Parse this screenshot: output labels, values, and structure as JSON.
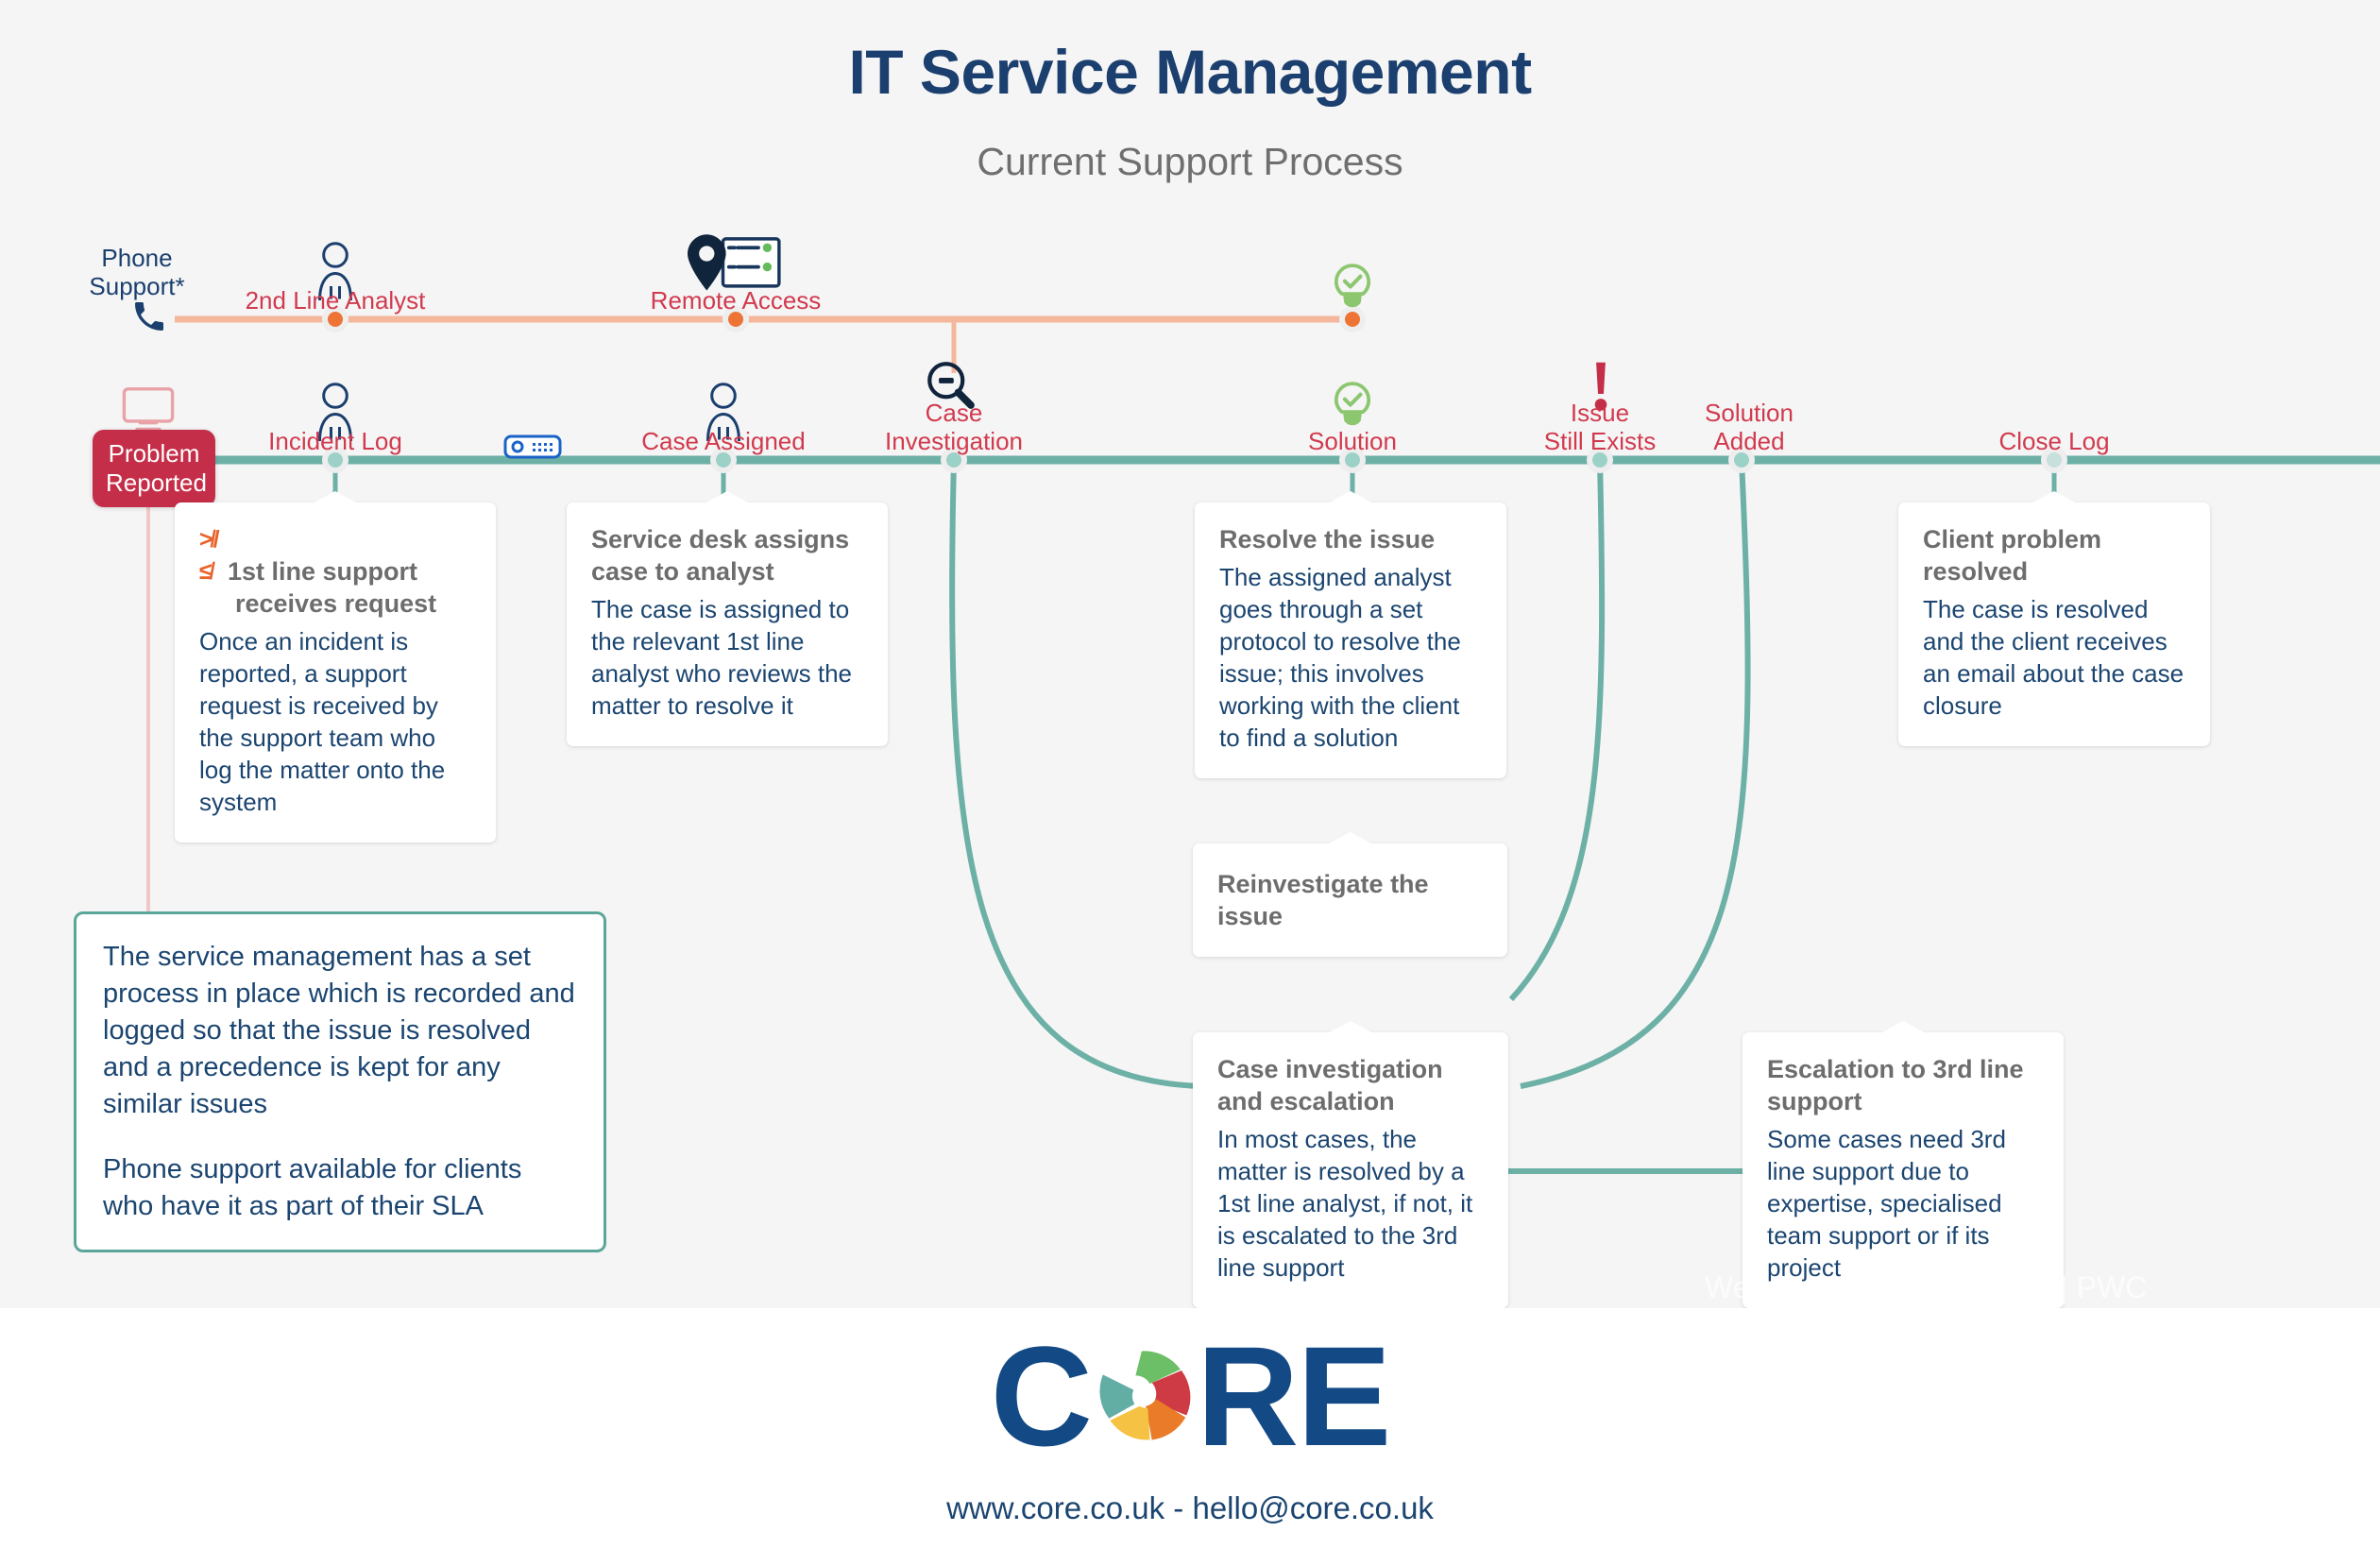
{
  "header": {
    "title": "IT Service Management",
    "subtitle": "Current Support Process"
  },
  "colors": {
    "title_blue": "#1b3f6e",
    "accent_red": "#d13a4e",
    "badge_red": "#c52e48",
    "timeline_teal": "#6cb0a6",
    "timeline_peach": "#f5b79b",
    "card_body_blue": "#1b4570",
    "card_title_grey": "#6d6d6d",
    "green": "#8cc76f",
    "background": "#f5f5f5"
  },
  "top_track": {
    "phone_support_label": "Phone\nSupport*",
    "nodes": [
      {
        "label": "2nd Line Analyst",
        "icon": "person-icon"
      },
      {
        "label": "Remote Access",
        "icon": "location-list-icon"
      },
      {
        "label": "",
        "icon": "lightbulb-check-icon"
      }
    ]
  },
  "main_track": {
    "badge": "Problem\nReported",
    "badge_icon": "monitor-icon",
    "nodes": [
      {
        "label": "Incident Log",
        "icon": "person-icon"
      },
      {
        "label": "Case Assigned",
        "icon": "person-icon"
      },
      {
        "label": "Case\nInvestigation",
        "icon": "magnifier-minus-icon"
      },
      {
        "label": "Solution",
        "icon": "lightbulb-check-icon"
      },
      {
        "label": "Issue\nStill Exists",
        "icon": "exclamation-icon"
      },
      {
        "label": "Solution\nAdded",
        "icon": ""
      },
      {
        "label": "Close Log",
        "icon": ""
      }
    ],
    "router_icon": "router-icon"
  },
  "cards": [
    {
      "id": "first-line-support",
      "icon": "code-brackets-icon",
      "title": "1st line support receives request",
      "body": "Once an incident is reported, a support request is received by the support team who log the matter onto the system"
    },
    {
      "id": "service-desk-assigns",
      "title": "Service desk assigns case to analyst",
      "body": "The case is assigned to the relevant 1st line analyst who reviews the matter to resolve it"
    },
    {
      "id": "resolve-the-issue",
      "title": "Resolve the issue",
      "body": "The assigned analyst goes through a set protocol to resolve the issue; this involves working with the client to find a solution"
    },
    {
      "id": "client-problem-resolved",
      "title": "Client problem resolved",
      "body": "The case is resolved and the client receives an email about the case closure"
    },
    {
      "id": "reinvestigate-the-issue",
      "title": "Reinvestigate the issue",
      "body": ""
    },
    {
      "id": "case-investigation-escalation",
      "title": "Case investigation and escalation",
      "body": "In most cases, the matter is resolved by a 1st line analyst, if not, it is escalated to the 3rd line support"
    },
    {
      "id": "escalation-3rd-line",
      "title": "Escalation to 3rd line support",
      "body": "Some cases need 3rd line support due to expertise, specialised team support or if its project"
    }
  ],
  "note": {
    "paragraph1": "The service management has a set process in place which is recorded and logged so that the issue is resolved and a precedence is kept for any similar issues",
    "paragraph2": "Phone support available for clients who have it as part of their SLA"
  },
  "watermark": "We ... ose the gender gap | PWC",
  "footer": {
    "logo_c": "C",
    "logo_re": "RE",
    "contact": "www.core.co.uk - hello@core.co.uk"
  }
}
